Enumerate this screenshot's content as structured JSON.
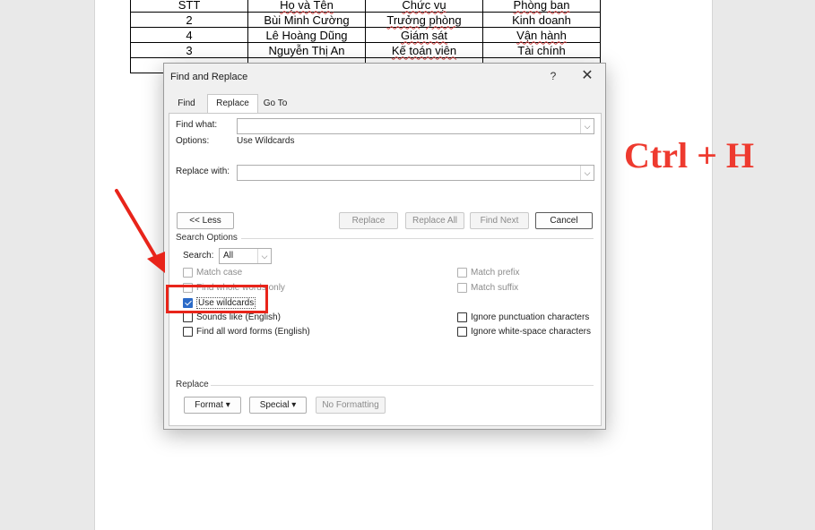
{
  "doc_table": {
    "rows": [
      [
        "STT",
        "Họ và Tên",
        "Chức vụ",
        "Phòng ban"
      ],
      [
        "2",
        "Bùi Minh Cường",
        "Trưởng phòng",
        "Kinh doanh"
      ],
      [
        "4",
        "Lê Hoàng Dũng",
        "Giám sát",
        "Vận hành"
      ],
      [
        "3",
        "Nguyễn Thị An",
        "Kế toán viên",
        "Tài chính"
      ],
      [
        "",
        "",
        "",
        ""
      ]
    ]
  },
  "hotkey_label": "Ctrl + H",
  "dialog": {
    "title": "Find and Replace",
    "help": "?",
    "close": "✕",
    "tabs": {
      "find": "Find",
      "replace": "Replace",
      "goto": "Go To"
    },
    "find_what_label": "Find what:",
    "find_what_value": "",
    "options_label": "Options:",
    "options_value": "Use Wildcards",
    "replace_with_label": "Replace with:",
    "replace_with_value": "",
    "buttons": {
      "less": "<< Less",
      "replace": "Replace",
      "replace_all": "Replace All",
      "find_next": "Find Next",
      "cancel": "Cancel"
    },
    "search_options_label": "Search Options",
    "search_label": "Search:",
    "search_value": "All",
    "options_left": {
      "match_case": "Match case",
      "whole_words": "Find whole words only",
      "use_wildcards": "Use wildcards",
      "sounds_like": "Sounds like (English)",
      "all_word_forms": "Find all word forms (English)"
    },
    "options_right": {
      "match_prefix": "Match prefix",
      "match_suffix": "Match suffix",
      "ignore_punct": "Ignore punctuation characters",
      "ignore_space": "Ignore white-space characters"
    },
    "replace_section_label": "Replace",
    "format_btn": "Format ▾",
    "special_btn": "Special ▾",
    "no_formatting_btn": "No Formatting"
  },
  "colors": {
    "annotation_red": "#e8241a",
    "checkbox_blue": "#2b6bc8"
  }
}
